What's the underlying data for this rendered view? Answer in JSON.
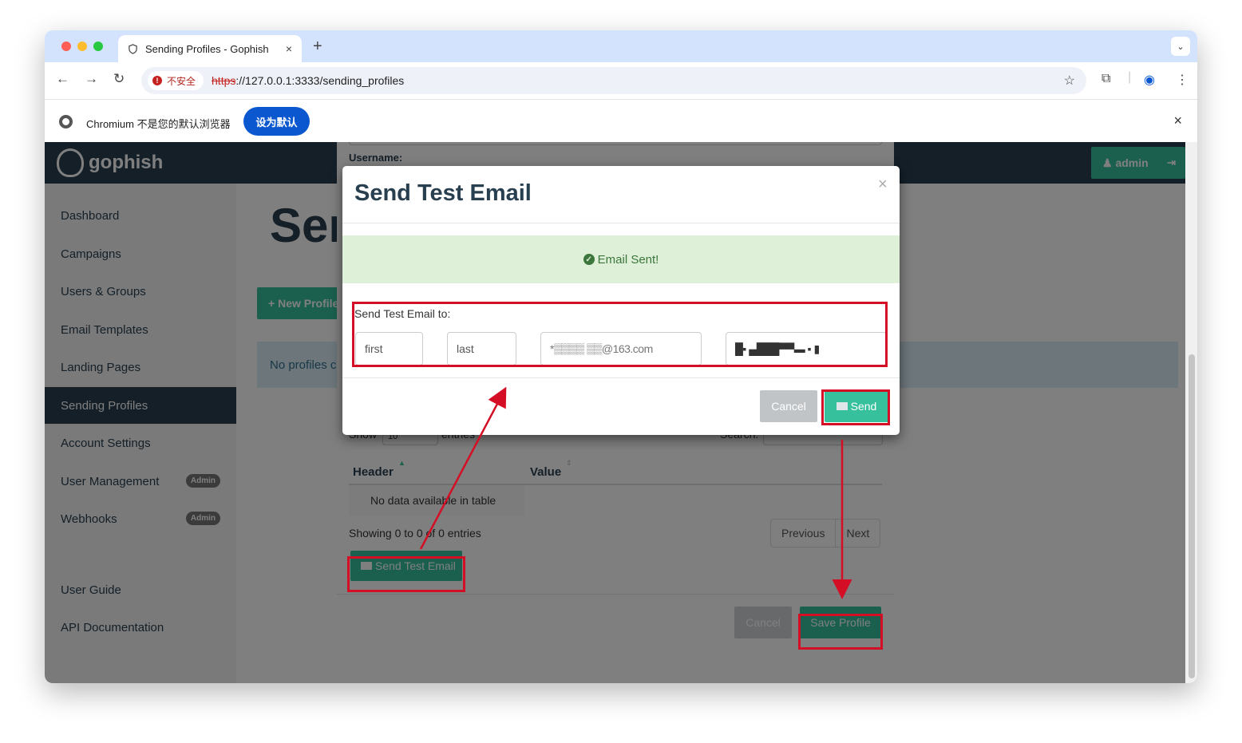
{
  "browser": {
    "tab_title": "Sending Profiles - Gophish",
    "tab_close": "×",
    "new_tab": "+",
    "tab_menu": "⌄",
    "back": "←",
    "forward": "→",
    "reload": "↻",
    "security_label": "不安全",
    "url_scheme": "https",
    "url_rest": "://127.0.0.1:3333/sending_profiles",
    "star": "☆",
    "extensions": "⧉",
    "profile": "◉",
    "menu": "⋮",
    "infobar_text": "Chromium 不是您的默认浏览器",
    "infobar_button": "设为默认",
    "infobar_close": "×"
  },
  "app": {
    "brand": "gophish",
    "user_label": "admin",
    "logout": "⇥",
    "page_title": "Sending Profiles",
    "new_profile_label": "New Profile",
    "no_profiles_text": "No profiles created yet. Let's create one!",
    "sidebar": [
      {
        "label": "Dashboard"
      },
      {
        "label": "Campaigns"
      },
      {
        "label": "Users & Groups"
      },
      {
        "label": "Email Templates"
      },
      {
        "label": "Landing Pages"
      },
      {
        "label": "Sending Profiles",
        "active": true
      },
      {
        "label": "Account Settings"
      },
      {
        "label": "User Management",
        "badge": "Admin"
      },
      {
        "label": "Webhooks",
        "badge": "Admin"
      },
      {
        "label": "User Guide"
      },
      {
        "label": "API Documentation"
      }
    ]
  },
  "edit_modal": {
    "username_label": "Username:",
    "show_label": "Show",
    "show_value": "10",
    "entries_label": "entries",
    "search_label": "Search:",
    "columns": [
      "Header",
      "Value"
    ],
    "empty_text": "No data available in table",
    "showing_text": "Showing 0 to 0 of 0 entries",
    "pager": [
      "Previous",
      "Next"
    ],
    "send_test_label": "Send Test Email",
    "cancel_label": "Cancel",
    "save_label": "Save Profile"
  },
  "test_modal": {
    "title": "Send Test Email",
    "close": "×",
    "alert_text": "Email Sent!",
    "to_label": "Send Test Email to:",
    "first_value": "first",
    "last_value": "last",
    "email_value": "*▒▒▒▒ ▒▒@163.com",
    "position_value": "█▪ ▄███▀▀▬ ▪ ▮",
    "cancel_label": "Cancel",
    "send_label": "Send"
  },
  "colors": {
    "navbar": "#283f50",
    "accent": "#37c09c",
    "annotation": "#d40f25",
    "alert_bg": "#dff0d8",
    "alert_text": "#3c763d"
  }
}
